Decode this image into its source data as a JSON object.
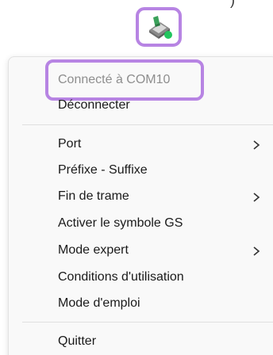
{
  "tray": {
    "icon": "scanner-connected-icon",
    "status_color": "#22c55e",
    "top_fragment": ")"
  },
  "menu": {
    "status": "Connecté à COM10",
    "disconnect": "Déconnecter",
    "items": [
      {
        "label": "Port",
        "submenu": true
      },
      {
        "label": "Préfixe - Suffixe",
        "submenu": false
      },
      {
        "label": "Fin de trame",
        "submenu": true
      },
      {
        "label": "Activer le symbole GS",
        "submenu": false
      },
      {
        "label": "Mode expert",
        "submenu": true
      },
      {
        "label": "Conditions d'utilisation",
        "submenu": false
      },
      {
        "label": "Mode d'emploi",
        "submenu": false
      }
    ],
    "quit": "Quitter"
  },
  "colors": {
    "highlight": "#b784e3",
    "menu_bg": "#f9f9f9",
    "disabled_text": "#8e8e8e"
  }
}
